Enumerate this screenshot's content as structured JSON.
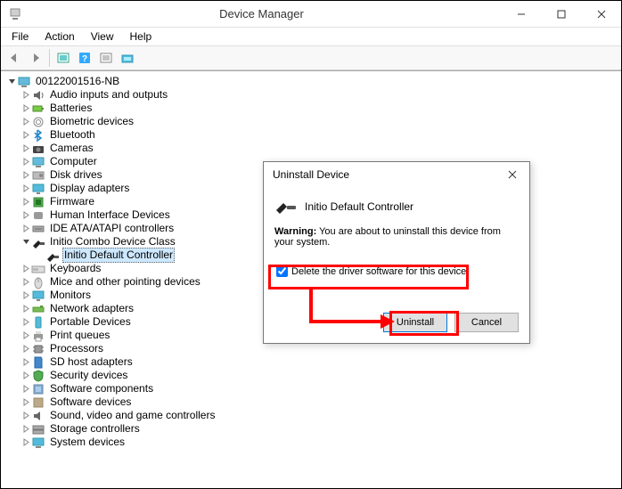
{
  "window": {
    "title": "Device Manager"
  },
  "menu": {
    "file": "File",
    "action": "Action",
    "view": "View",
    "help": "Help"
  },
  "tree": {
    "root": "00122001516-NB",
    "items": [
      "Audio inputs and outputs",
      "Batteries",
      "Biometric devices",
      "Bluetooth",
      "Cameras",
      "Computer",
      "Disk drives",
      "Display adapters",
      "Firmware",
      "Human Interface Devices",
      "IDE ATA/ATAPI controllers"
    ],
    "combo": "Initio Combo Device Class",
    "combo_child": "Initio Default Controller",
    "items2": [
      "Keyboards",
      "Mice and other pointing devices",
      "Monitors",
      "Network adapters",
      "Portable Devices",
      "Print queues",
      "Processors",
      "SD host adapters",
      "Security devices",
      "Software components",
      "Software devices",
      "Sound, video and game controllers",
      "Storage controllers",
      "System devices"
    ]
  },
  "dialog": {
    "title": "Uninstall Device",
    "device": "Initio Default Controller",
    "warning_label": "Warning:",
    "warning_text": " You are about to uninstall this device from your system.",
    "checkbox": "Delete the driver software for this device.",
    "uninstall": "Uninstall",
    "cancel": "Cancel"
  }
}
